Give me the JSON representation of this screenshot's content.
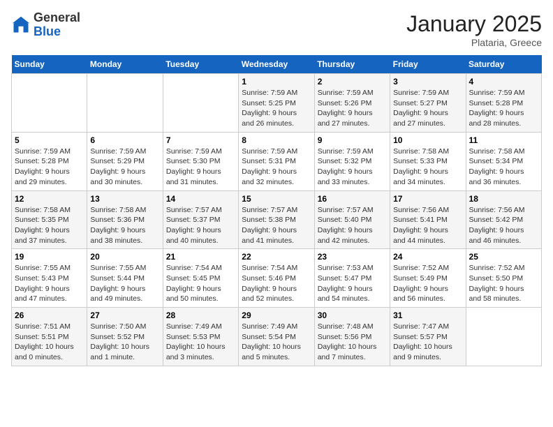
{
  "header": {
    "logo_general": "General",
    "logo_blue": "Blue",
    "month_year": "January 2025",
    "location": "Plataria, Greece"
  },
  "days_of_week": [
    "Sunday",
    "Monday",
    "Tuesday",
    "Wednesday",
    "Thursday",
    "Friday",
    "Saturday"
  ],
  "weeks": [
    [
      {
        "day": "",
        "info": ""
      },
      {
        "day": "",
        "info": ""
      },
      {
        "day": "",
        "info": ""
      },
      {
        "day": "1",
        "info": "Sunrise: 7:59 AM\nSunset: 5:25 PM\nDaylight: 9 hours\nand 26 minutes."
      },
      {
        "day": "2",
        "info": "Sunrise: 7:59 AM\nSunset: 5:26 PM\nDaylight: 9 hours\nand 27 minutes."
      },
      {
        "day": "3",
        "info": "Sunrise: 7:59 AM\nSunset: 5:27 PM\nDaylight: 9 hours\nand 27 minutes."
      },
      {
        "day": "4",
        "info": "Sunrise: 7:59 AM\nSunset: 5:28 PM\nDaylight: 9 hours\nand 28 minutes."
      }
    ],
    [
      {
        "day": "5",
        "info": "Sunrise: 7:59 AM\nSunset: 5:28 PM\nDaylight: 9 hours\nand 29 minutes."
      },
      {
        "day": "6",
        "info": "Sunrise: 7:59 AM\nSunset: 5:29 PM\nDaylight: 9 hours\nand 30 minutes."
      },
      {
        "day": "7",
        "info": "Sunrise: 7:59 AM\nSunset: 5:30 PM\nDaylight: 9 hours\nand 31 minutes."
      },
      {
        "day": "8",
        "info": "Sunrise: 7:59 AM\nSunset: 5:31 PM\nDaylight: 9 hours\nand 32 minutes."
      },
      {
        "day": "9",
        "info": "Sunrise: 7:59 AM\nSunset: 5:32 PM\nDaylight: 9 hours\nand 33 minutes."
      },
      {
        "day": "10",
        "info": "Sunrise: 7:58 AM\nSunset: 5:33 PM\nDaylight: 9 hours\nand 34 minutes."
      },
      {
        "day": "11",
        "info": "Sunrise: 7:58 AM\nSunset: 5:34 PM\nDaylight: 9 hours\nand 36 minutes."
      }
    ],
    [
      {
        "day": "12",
        "info": "Sunrise: 7:58 AM\nSunset: 5:35 PM\nDaylight: 9 hours\nand 37 minutes."
      },
      {
        "day": "13",
        "info": "Sunrise: 7:58 AM\nSunset: 5:36 PM\nDaylight: 9 hours\nand 38 minutes."
      },
      {
        "day": "14",
        "info": "Sunrise: 7:57 AM\nSunset: 5:37 PM\nDaylight: 9 hours\nand 40 minutes."
      },
      {
        "day": "15",
        "info": "Sunrise: 7:57 AM\nSunset: 5:38 PM\nDaylight: 9 hours\nand 41 minutes."
      },
      {
        "day": "16",
        "info": "Sunrise: 7:57 AM\nSunset: 5:40 PM\nDaylight: 9 hours\nand 42 minutes."
      },
      {
        "day": "17",
        "info": "Sunrise: 7:56 AM\nSunset: 5:41 PM\nDaylight: 9 hours\nand 44 minutes."
      },
      {
        "day": "18",
        "info": "Sunrise: 7:56 AM\nSunset: 5:42 PM\nDaylight: 9 hours\nand 46 minutes."
      }
    ],
    [
      {
        "day": "19",
        "info": "Sunrise: 7:55 AM\nSunset: 5:43 PM\nDaylight: 9 hours\nand 47 minutes."
      },
      {
        "day": "20",
        "info": "Sunrise: 7:55 AM\nSunset: 5:44 PM\nDaylight: 9 hours\nand 49 minutes."
      },
      {
        "day": "21",
        "info": "Sunrise: 7:54 AM\nSunset: 5:45 PM\nDaylight: 9 hours\nand 50 minutes."
      },
      {
        "day": "22",
        "info": "Sunrise: 7:54 AM\nSunset: 5:46 PM\nDaylight: 9 hours\nand 52 minutes."
      },
      {
        "day": "23",
        "info": "Sunrise: 7:53 AM\nSunset: 5:47 PM\nDaylight: 9 hours\nand 54 minutes."
      },
      {
        "day": "24",
        "info": "Sunrise: 7:52 AM\nSunset: 5:49 PM\nDaylight: 9 hours\nand 56 minutes."
      },
      {
        "day": "25",
        "info": "Sunrise: 7:52 AM\nSunset: 5:50 PM\nDaylight: 9 hours\nand 58 minutes."
      }
    ],
    [
      {
        "day": "26",
        "info": "Sunrise: 7:51 AM\nSunset: 5:51 PM\nDaylight: 10 hours\nand 0 minutes."
      },
      {
        "day": "27",
        "info": "Sunrise: 7:50 AM\nSunset: 5:52 PM\nDaylight: 10 hours\nand 1 minute."
      },
      {
        "day": "28",
        "info": "Sunrise: 7:49 AM\nSunset: 5:53 PM\nDaylight: 10 hours\nand 3 minutes."
      },
      {
        "day": "29",
        "info": "Sunrise: 7:49 AM\nSunset: 5:54 PM\nDaylight: 10 hours\nand 5 minutes."
      },
      {
        "day": "30",
        "info": "Sunrise: 7:48 AM\nSunset: 5:56 PM\nDaylight: 10 hours\nand 7 minutes."
      },
      {
        "day": "31",
        "info": "Sunrise: 7:47 AM\nSunset: 5:57 PM\nDaylight: 10 hours\nand 9 minutes."
      },
      {
        "day": "",
        "info": ""
      }
    ]
  ]
}
